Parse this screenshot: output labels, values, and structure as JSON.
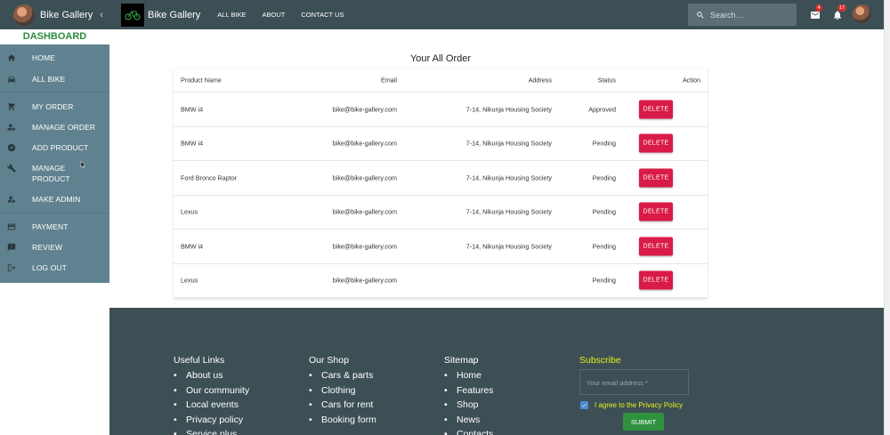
{
  "drawer": {
    "title": "Bike Gallery",
    "dashboard_label": "DASHBOARD",
    "items": [
      {
        "label": "HOME",
        "icon": "home-icon"
      },
      {
        "label": "ALL BIKE",
        "icon": "car-icon"
      },
      {
        "label": "MY ORDER",
        "icon": "cart-icon"
      },
      {
        "label": "MANAGE ORDER",
        "icon": "manage-accounts-icon"
      },
      {
        "label": "ADD PRODUCT",
        "icon": "add-circle-icon"
      },
      {
        "label": "MANAGE PRODUCT",
        "icon": "tools-icon"
      },
      {
        "label": "MAKE ADMIN",
        "icon": "admin-icon"
      },
      {
        "label": "PAYMENT",
        "icon": "credit-card-icon"
      },
      {
        "label": "REVIEW",
        "icon": "review-icon"
      },
      {
        "label": "LOG OUT",
        "icon": "logout-icon"
      }
    ]
  },
  "topbar": {
    "brand": "Bike Gallery",
    "links": [
      "ALL BIKE",
      "ABOUT",
      "CONTACT US"
    ],
    "search_placeholder": "Search…",
    "mail_badge": "4",
    "notif_badge": "17"
  },
  "orders": {
    "title": "Your All Order",
    "headers": {
      "name": "Product Name",
      "email": "Email",
      "address": "Address",
      "status": "Status",
      "action": "Action"
    },
    "delete_label": "DELETE",
    "rows": [
      {
        "name": "BMW i4",
        "email": "bike@bike-gallery.com",
        "address": "7-14, Nikunja Housing Society",
        "status": "Approved"
      },
      {
        "name": "BMW i4",
        "email": "bike@bike-gallery.com",
        "address": "7-14, Nikunja Housing Society",
        "status": "Pending"
      },
      {
        "name": "Ford Bronco Raptor",
        "email": "bike@bike-gallery.com",
        "address": "7-14, Nikunja Housing Society",
        "status": "Pending"
      },
      {
        "name": "Lexus",
        "email": "bike@bike-gallery.com",
        "address": "7-14, Nikunja Housing Society",
        "status": "Pending"
      },
      {
        "name": "BMW i4",
        "email": "bike@bike-gallery.com",
        "address": "7-14, Nikunja Housing Society",
        "status": "Pending"
      },
      {
        "name": "Lexus",
        "email": "bike@bike-gallery.com",
        "address": "",
        "status": "Pending"
      }
    ]
  },
  "footer": {
    "useful_links": {
      "title": "Useful Links",
      "items": [
        "About us",
        "Our community",
        "Local events",
        "Privacy policy",
        "Service plus"
      ]
    },
    "shop": {
      "title": "Our Shop",
      "items": [
        "Cars & parts",
        "Clothing",
        "Cars for rent",
        "Booking form"
      ]
    },
    "sitemap": {
      "title": "Sitemap",
      "items": [
        "Home",
        "Features",
        "Shop",
        "News",
        "Contacts"
      ]
    },
    "subscribe": {
      "title": "Subscribe",
      "email_placeholder": "Your email address *",
      "agree_label": "I agree to the Privacy Policy",
      "submit_label": "SUBMIT"
    }
  },
  "colors": {
    "topbar": "#3c4f55",
    "drawer": "#608290",
    "delete": "#d81b48",
    "dashboard": "#2e8b3e",
    "subscribe": "#e6ee1e"
  }
}
